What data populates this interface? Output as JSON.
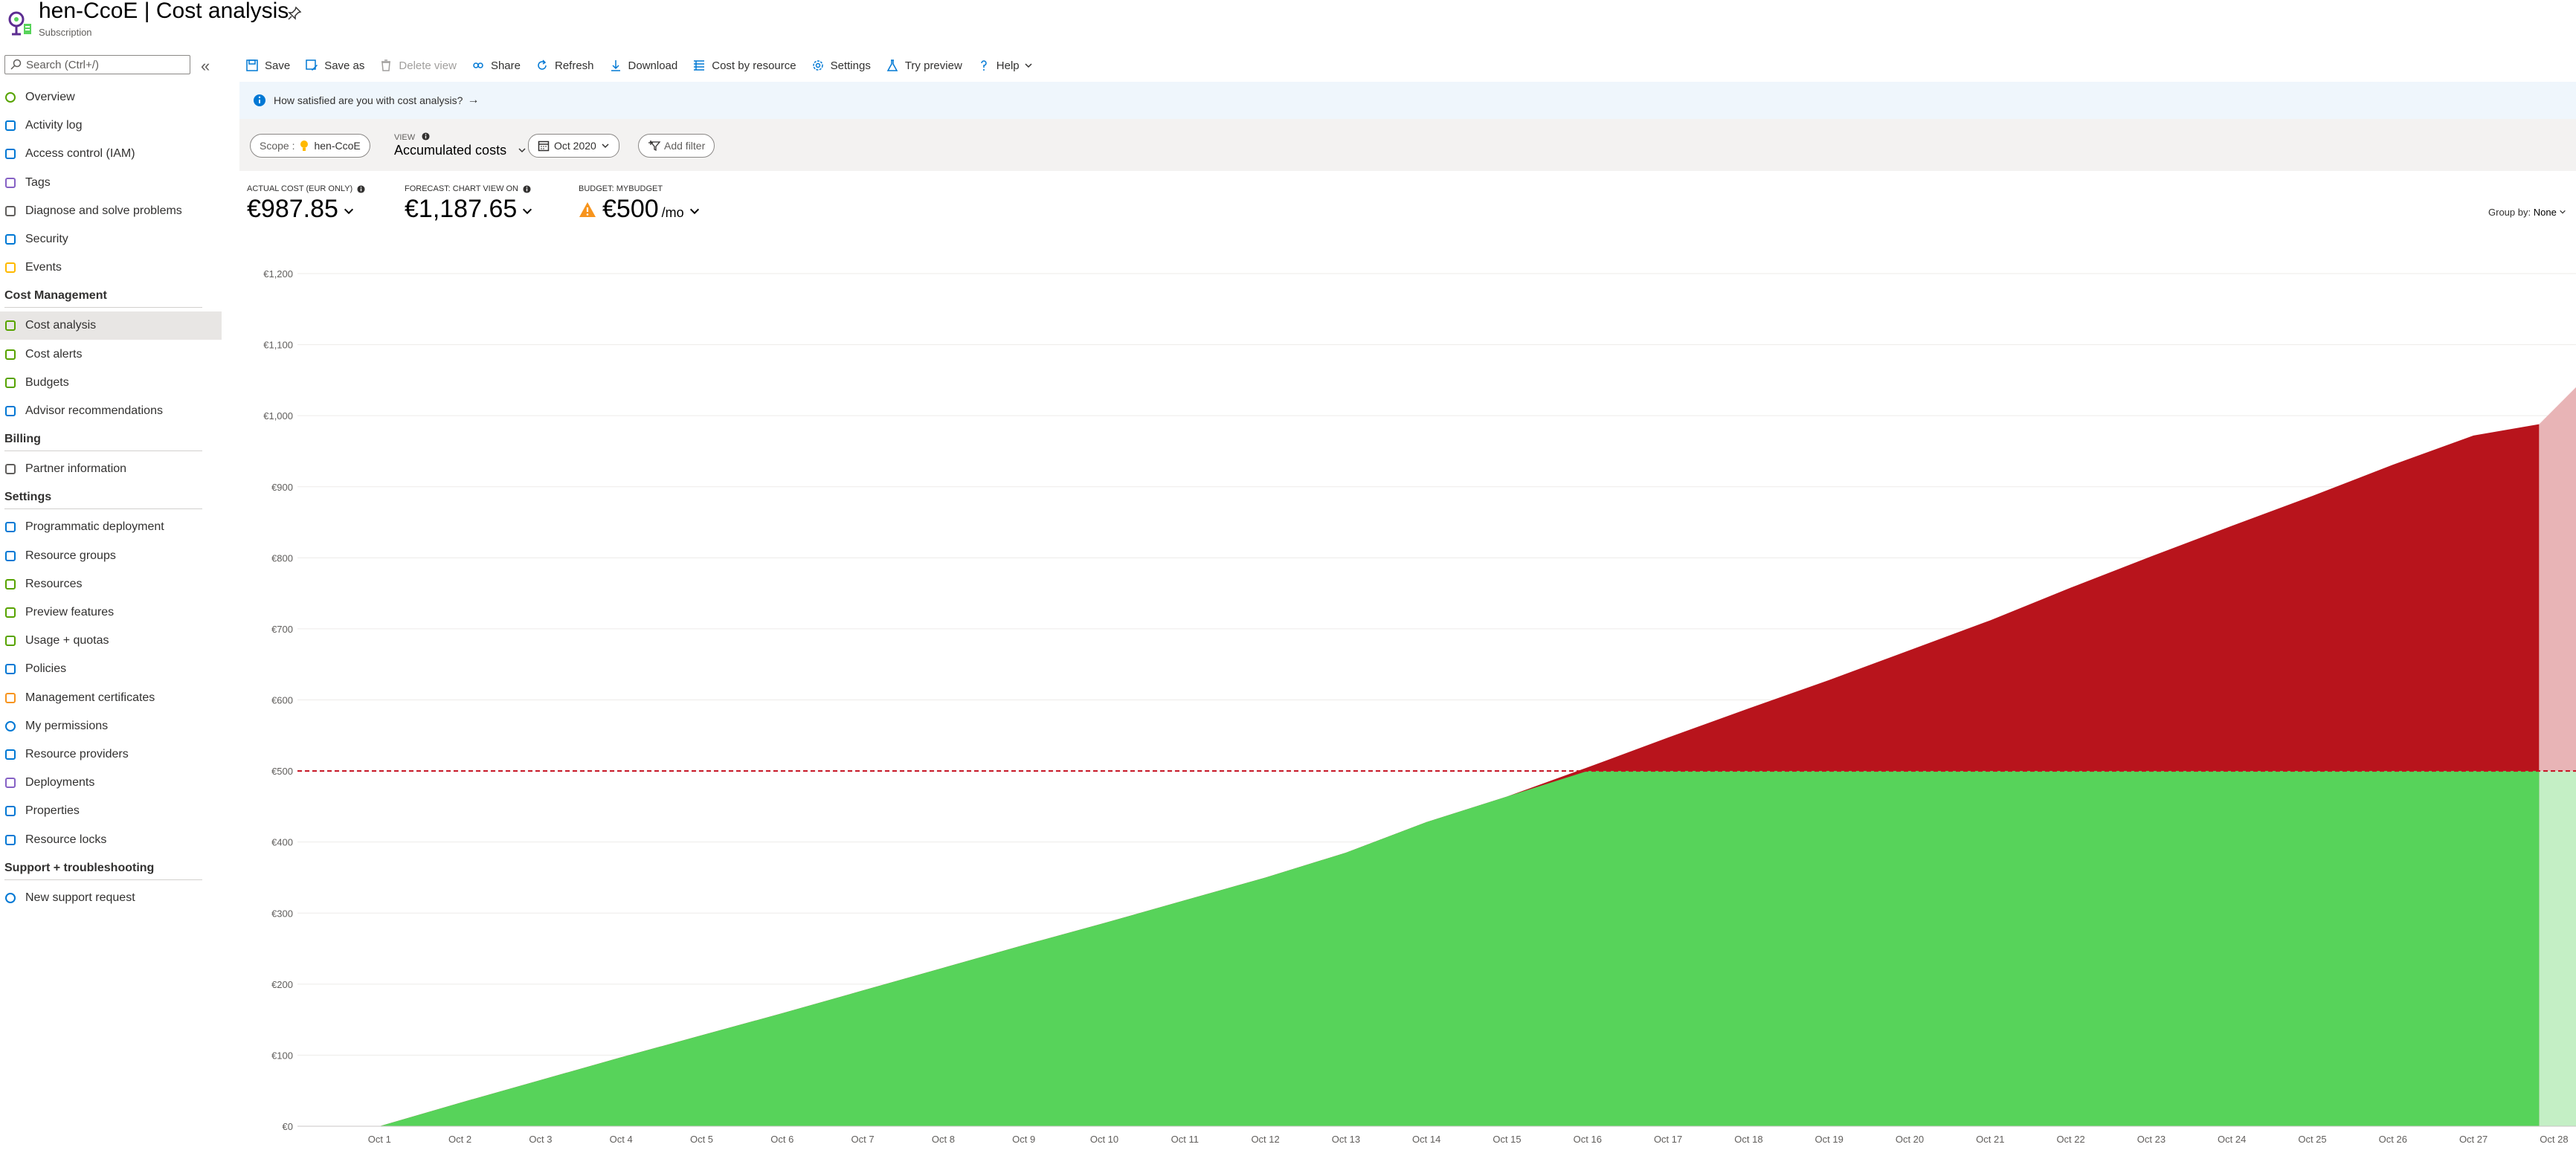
{
  "header": {
    "title": "hen-CcoE | Cost analysis",
    "subtitle": "Subscription"
  },
  "sidebar": {
    "search_placeholder": "Search (Ctrl+/)",
    "collapse_glyph": "«",
    "top_items": [
      {
        "label": "Overview",
        "icon": "overview-icon"
      },
      {
        "label": "Activity log",
        "icon": "activity-log-icon"
      },
      {
        "label": "Access control (IAM)",
        "icon": "iam-icon"
      },
      {
        "label": "Tags",
        "icon": "tag-icon"
      },
      {
        "label": "Diagnose and solve problems",
        "icon": "wrench-icon"
      },
      {
        "label": "Security",
        "icon": "shield-icon"
      },
      {
        "label": "Events",
        "icon": "lightning-icon"
      }
    ],
    "cost_management": {
      "heading": "Cost Management",
      "items": [
        {
          "label": "Cost analysis",
          "icon": "cost-analysis-icon",
          "active": true
        },
        {
          "label": "Cost alerts",
          "icon": "cost-alerts-icon"
        },
        {
          "label": "Budgets",
          "icon": "budgets-icon"
        },
        {
          "label": "Advisor recommendations",
          "icon": "advisor-icon"
        }
      ]
    },
    "billing": {
      "heading": "Billing",
      "items": [
        {
          "label": "Partner information",
          "icon": "partner-icon"
        }
      ]
    },
    "settings": {
      "heading": "Settings",
      "items": [
        {
          "label": "Programmatic deployment",
          "icon": "programmatic-icon"
        },
        {
          "label": "Resource groups",
          "icon": "resource-groups-icon"
        },
        {
          "label": "Resources",
          "icon": "resources-grid-icon"
        },
        {
          "label": "Preview features",
          "icon": "preview-features-icon"
        },
        {
          "label": "Usage + quotas",
          "icon": "usage-quotas-icon"
        },
        {
          "label": "Policies",
          "icon": "policies-icon"
        },
        {
          "label": "Management certificates",
          "icon": "certificate-icon"
        },
        {
          "label": "My permissions",
          "icon": "person-icon"
        },
        {
          "label": "Resource providers",
          "icon": "list-icon"
        },
        {
          "label": "Deployments",
          "icon": "deployments-icon"
        },
        {
          "label": "Properties",
          "icon": "properties-icon"
        },
        {
          "label": "Resource locks",
          "icon": "lock-icon"
        }
      ]
    },
    "support": {
      "heading": "Support + troubleshooting",
      "items": [
        {
          "label": "New support request",
          "icon": "support-person-icon"
        }
      ]
    }
  },
  "toolbar": {
    "save": "Save",
    "save_as": "Save as",
    "delete_view": "Delete view",
    "share": "Share",
    "refresh": "Refresh",
    "download": "Download",
    "cost_by_resource": "Cost by resource",
    "settings": "Settings",
    "try_preview": "Try preview",
    "help": "Help"
  },
  "banner": {
    "text": "How satisfied are you with cost analysis?",
    "arrow": "→"
  },
  "filters": {
    "scope_label": "Scope :",
    "scope_value": "hen-CcoE",
    "view_label": "VIEW",
    "view_value": "Accumulated costs",
    "date_value": "Oct 2020",
    "add_filter": "Add filter"
  },
  "kpis": {
    "actual_label": "ACTUAL COST (EUR ONLY)",
    "actual_value": "€987.85",
    "forecast_label": "FORECAST: CHART VIEW ON",
    "forecast_value": "€1,187.65",
    "budget_label": "BUDGET: MYBUDGET",
    "budget_value": "€500",
    "budget_unit": "/mo"
  },
  "group_by": {
    "label": "Group by:",
    "value": "None"
  },
  "colors": {
    "accent": "#0078d4",
    "under_budget": "#57d35a",
    "over_budget": "#b8141c",
    "forecast_over": "#e8b4b6",
    "forecast_under": "#c4efc5",
    "budget_line": "#c50f1f",
    "warning": "#f7941d"
  },
  "chart_data": {
    "type": "area",
    "title": "",
    "xlabel": "",
    "ylabel": "",
    "x": [
      "Oct 1",
      "Oct 2",
      "Oct 3",
      "Oct 4",
      "Oct 5",
      "Oct 6",
      "Oct 7",
      "Oct 8",
      "Oct 9",
      "Oct 10",
      "Oct 11",
      "Oct 12",
      "Oct 13",
      "Oct 14",
      "Oct 15",
      "Oct 16",
      "Oct 17",
      "Oct 18",
      "Oct 19",
      "Oct 20",
      "Oct 21",
      "Oct 22",
      "Oct 23",
      "Oct 24",
      "Oct 25",
      "Oct 26",
      "Oct 27",
      "Oct 28"
    ],
    "ylim": [
      0,
      1200
    ],
    "yticks": [
      "€0",
      "€100",
      "€200",
      "€300",
      "€400",
      "€500",
      "€600",
      "€700",
      "€800",
      "€900",
      "€1,000",
      "€1,100",
      "€1,200"
    ],
    "ytick_values": [
      0,
      100,
      200,
      300,
      400,
      500,
      600,
      700,
      800,
      900,
      1000,
      1100,
      1200
    ],
    "series": [
      {
        "name": "Actual cost",
        "values": [
          0,
          33,
          65,
          97,
          128,
          159,
          191,
          223,
          255,
          286,
          318,
          350,
          385,
          428,
          464,
          505,
          547,
          588,
          628,
          670,
          712,
          758,
          802,
          845,
          887,
          931,
          972,
          988
        ]
      },
      {
        "name": "Forecast",
        "values": [
          988,
          1040
        ]
      }
    ],
    "budget": 500,
    "grid": true
  }
}
